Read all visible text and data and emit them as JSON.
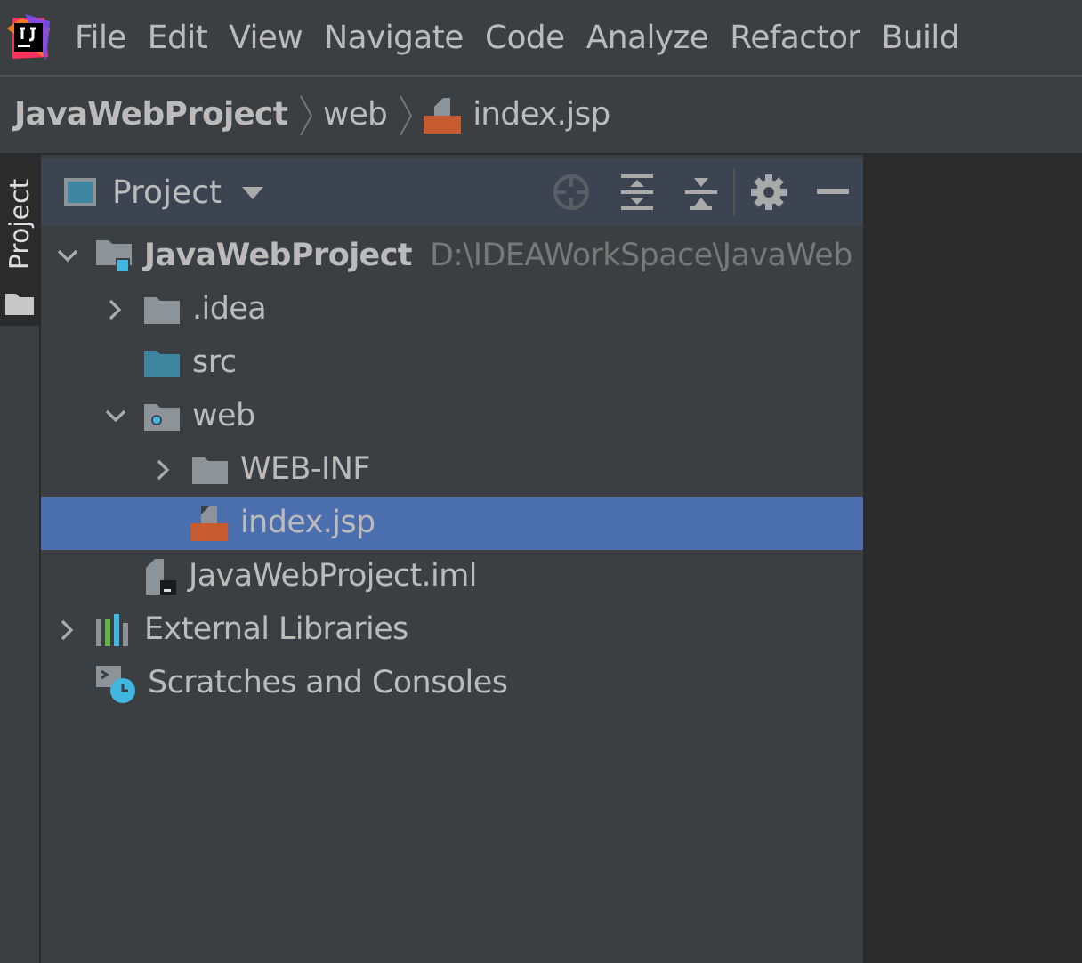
{
  "menu_bar": {
    "items": [
      {
        "label": "File"
      },
      {
        "label": "Edit"
      },
      {
        "label": "View"
      },
      {
        "label": "Navigate"
      },
      {
        "label": "Code"
      },
      {
        "label": "Analyze"
      },
      {
        "label": "Refactor"
      },
      {
        "label": "Build"
      }
    ]
  },
  "breadcrumbs": [
    {
      "label": "JavaWebProject",
      "kind": "project"
    },
    {
      "label": "web",
      "kind": "folder"
    },
    {
      "label": "index.jsp",
      "kind": "jsp"
    }
  ],
  "side_strip": {
    "tab": "Project"
  },
  "project_panel": {
    "title": "Project",
    "tree": [
      {
        "label": "JavaWebProject",
        "path": "D:\\IDEAWorkSpace\\JavaWeb",
        "kind": "project",
        "expanded": true,
        "selected": false,
        "children": [
          {
            "label": ".idea",
            "kind": "folder",
            "expanded": false,
            "selected": false
          },
          {
            "label": "src",
            "kind": "source",
            "selected": false
          },
          {
            "label": "web",
            "kind": "web",
            "expanded": true,
            "selected": false,
            "children": [
              {
                "label": "WEB-INF",
                "kind": "folder",
                "expanded": false,
                "selected": false
              },
              {
                "label": "index.jsp",
                "kind": "jsp",
                "selected": true
              }
            ]
          },
          {
            "label": "JavaWebProject.iml",
            "kind": "iml",
            "selected": false
          }
        ]
      },
      {
        "label": "External Libraries",
        "kind": "libraries",
        "expanded": false,
        "selected": false
      },
      {
        "label": "Scratches and Consoles",
        "kind": "scratches",
        "selected": false
      }
    ]
  }
}
